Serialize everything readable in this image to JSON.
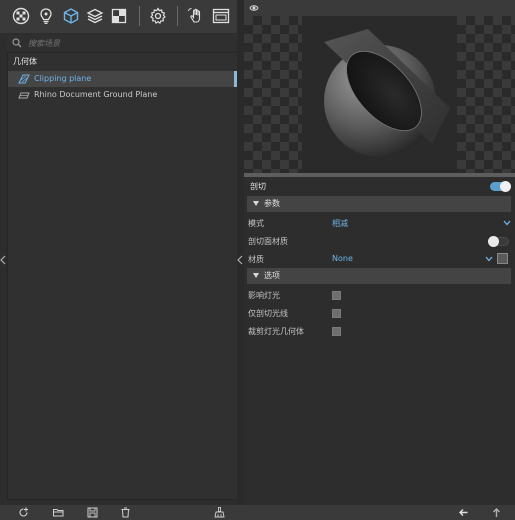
{
  "toolbar": {
    "icons": [
      "render-settings-icon",
      "lights-icon",
      "geometry-icon",
      "layers-icon",
      "environment-icon",
      "settings-icon",
      "hand-gesture-icon",
      "display-icon"
    ]
  },
  "search": {
    "placeholder": "搜索场景"
  },
  "tree": {
    "header": "几何体",
    "items": [
      {
        "label": "Clipping plane",
        "selected": true,
        "icon": "clipping-plane-icon"
      },
      {
        "label": "Rhino Document Ground Plane",
        "selected": false,
        "icon": "ground-plane-icon"
      }
    ]
  },
  "properties": {
    "title": "剖切",
    "enabled": true,
    "section_params": "参数",
    "mode_label": "模式",
    "mode_value": "相减",
    "fill_label": "剖切面材质",
    "fill_enabled": false,
    "material_label": "材质",
    "material_value": "None",
    "section_options": "选项",
    "options": [
      {
        "label": "影响灯光",
        "checked": false
      },
      {
        "label": "仅剖切光线",
        "checked": false
      },
      {
        "label": "裁剪灯光几何体",
        "checked": false
      }
    ]
  },
  "colors": {
    "accent": "#6fb4e8",
    "toggle_on": "#5c9fcf",
    "panel": "#2d2d2d",
    "toolbar": "#3a3a3a"
  }
}
